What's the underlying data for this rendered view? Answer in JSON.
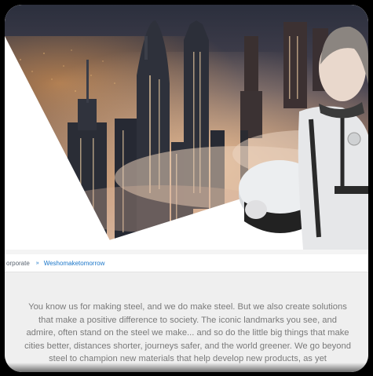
{
  "breadcrumb": {
    "parent": "orporate",
    "separator": "»",
    "current": "Weshomaketomorrow"
  },
  "intro": {
    "text": "You know us for making steel, and we do make steel. But we also create solutions that make a positive difference to society. The iconic landmarks you see, and admire, often stand on the steel we make... and so do the little big things that make cities better, distances shorter, journeys safer, and the world greener. We go beyond steel to champion new materials that help develop new products, as yet"
  },
  "colors": {
    "accent": "#1a76c9",
    "body_text": "#7a7a7a",
    "background": "#efefef"
  },
  "hero": {
    "image": "city-skyline-with-child-astronaut"
  }
}
